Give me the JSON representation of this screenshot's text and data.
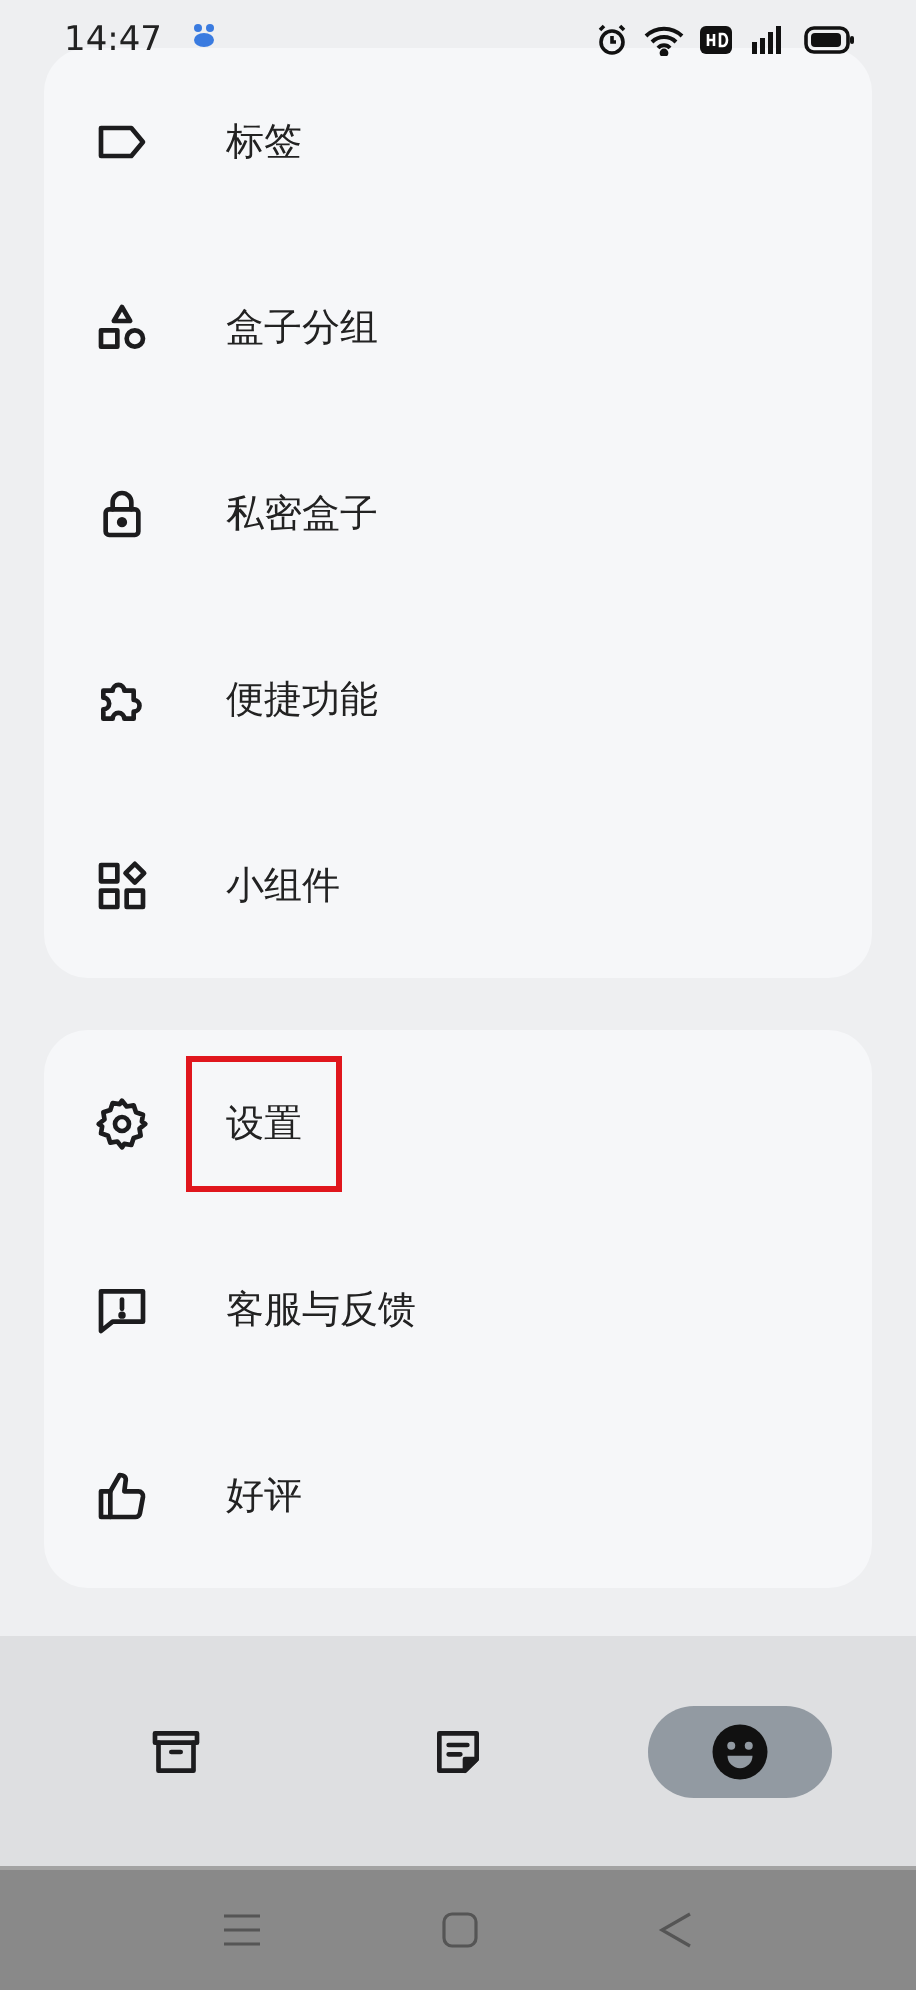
{
  "status_bar": {
    "time": "14:47"
  },
  "menu_groups": [
    {
      "items": [
        {
          "label": "标签",
          "highlighted": false
        },
        {
          "label": "盒子分组",
          "highlighted": false
        },
        {
          "label": "私密盒子",
          "highlighted": false
        },
        {
          "label": "便捷功能",
          "highlighted": false
        },
        {
          "label": "小组件",
          "highlighted": false
        }
      ]
    },
    {
      "items": [
        {
          "label": "设置",
          "highlighted": true
        },
        {
          "label": "客服与反馈",
          "highlighted": false
        },
        {
          "label": "好评",
          "highlighted": false
        }
      ]
    }
  ],
  "bottom_nav": [
    {
      "selected": false
    },
    {
      "selected": false
    },
    {
      "selected": true
    }
  ]
}
